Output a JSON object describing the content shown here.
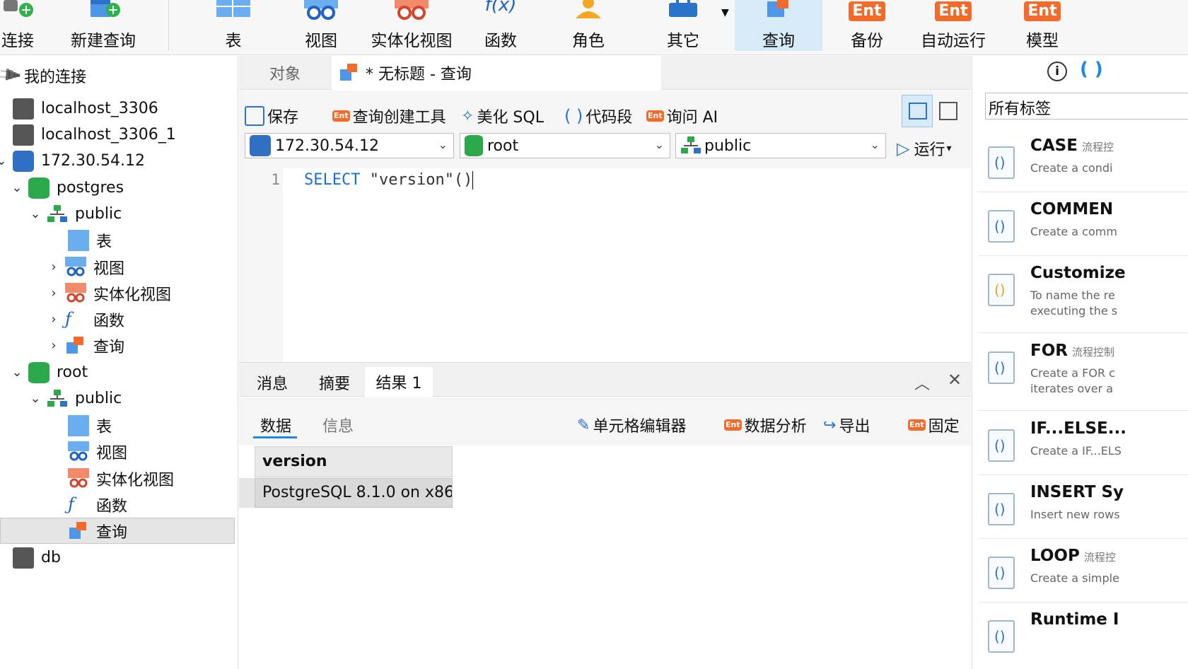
{
  "toolbar": {
    "items": [
      {
        "label": "连接"
      },
      {
        "label": "新建查询"
      },
      {
        "label": "表"
      },
      {
        "label": "视图"
      },
      {
        "label": "实体化视图"
      },
      {
        "label": "函数"
      },
      {
        "label": "角色"
      },
      {
        "label": "其它"
      },
      {
        "label": "查询"
      },
      {
        "label": "备份"
      },
      {
        "label": "自动运行"
      },
      {
        "label": "模型"
      }
    ],
    "ent_badge": "Ent",
    "function_glyph": "f(x)"
  },
  "tree": {
    "header": "我的连接",
    "nodes": [
      {
        "label": "localhost_3306"
      },
      {
        "label": "localhost_3306_1"
      },
      {
        "label": "172.30.54.12"
      },
      {
        "label": "postgres"
      },
      {
        "label": "public"
      },
      {
        "label": "表"
      },
      {
        "label": "视图"
      },
      {
        "label": "实体化视图"
      },
      {
        "label": "函数"
      },
      {
        "label": "查询"
      },
      {
        "label": "root"
      },
      {
        "label": "public"
      },
      {
        "label": "表"
      },
      {
        "label": "视图"
      },
      {
        "label": "实体化视图"
      },
      {
        "label": "函数"
      },
      {
        "label": "查询"
      },
      {
        "label": "db"
      }
    ]
  },
  "tabs": {
    "objects": "对象",
    "query": "* 无标题 - 查询"
  },
  "query_toolbar": {
    "save": "保存",
    "builder": "查询创建工具",
    "beautify": "美化 SQL",
    "snippet": "代码段",
    "ask_ai": "询问 AI",
    "run": "运行",
    "connection": "172.30.54.12",
    "database": "root",
    "schema": "public"
  },
  "editor": {
    "line_number": "1",
    "keyword": "SELECT",
    "rest": " \"version\"()"
  },
  "results": {
    "tabs": [
      "消息",
      "摘要",
      "结果 1"
    ],
    "subtabs": [
      "数据",
      "信息"
    ],
    "tools": {
      "cell_editor": "单元格编辑器",
      "data_analysis": "数据分析",
      "export": "导出",
      "pin": "固定"
    },
    "table": {
      "header": "version",
      "rows": [
        "PostgreSQL 8.1.0 on x86"
      ]
    }
  },
  "right_panel": {
    "tag_filter": "所有标签",
    "snippets": [
      {
        "title": "CASE",
        "tag": "流程控",
        "desc": "Create a condi",
        "icon_color": "#2f6fc4"
      },
      {
        "title": "COMMEN",
        "tag": "",
        "desc": "Create a comm",
        "icon_color": "#2f6fc4"
      },
      {
        "title": "Customize",
        "tag": "",
        "desc": "To name the re\nexecuting the s",
        "icon_color": "#e0a820"
      },
      {
        "title": "FOR",
        "tag": "流程控制",
        "desc": "Create a FOR c\niterates over a",
        "icon_color": "#2f6fc4"
      },
      {
        "title": "IF...ELSE...",
        "tag": "",
        "desc": "Create a IF...ELS",
        "icon_color": "#2f6fc4"
      },
      {
        "title": "INSERT Sy",
        "tag": "",
        "desc": "Insert new rows",
        "icon_color": "#2f6fc4"
      },
      {
        "title": "LOOP",
        "tag": "流程控",
        "desc": "Create a simple",
        "icon_color": "#2f6fc4"
      },
      {
        "title": "Runtime I",
        "tag": "",
        "desc": "",
        "icon_color": "#2f6fc4"
      }
    ]
  },
  "colors": {
    "accent": "#1e88e5",
    "selected_toolbar": "#d6eaf8",
    "ent_orange": "#f26b2a",
    "keyword_blue": "#1a6fd6"
  }
}
